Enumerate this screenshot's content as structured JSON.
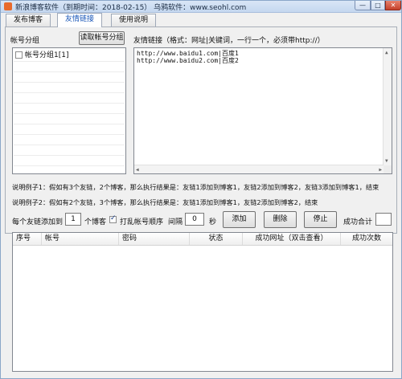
{
  "window": {
    "title": "新浪博客软件（到期时间：2018-02-15）   乌鸦软件：www.seohl.com",
    "min_glyph": "—",
    "max_glyph": "□",
    "close_glyph": "✕"
  },
  "tabs": [
    {
      "label": "发布博客",
      "active": false
    },
    {
      "label": "友情链接",
      "active": true
    },
    {
      "label": "使用说明",
      "active": false
    }
  ],
  "account_section": {
    "label": "帐号分组",
    "read_button": "读取帐号分组",
    "groups": [
      {
        "label": "帐号分组1[1]",
        "checked": false
      }
    ]
  },
  "friend_links": {
    "label": "友情链接（格式：网址|关键词，一行一个，必须带http://）",
    "lines": [
      "http://www.baidu1.com|百度1",
      "http://www.baidu2.com|百度2"
    ]
  },
  "examples": {
    "line1": "说明例子1：假如有3个友链，2个博客，那么执行结果是：友链1添加到博客1，友链2添加到博客2，友链3添加到博客1，结束",
    "line2": "说明例子2：假如有2个友链，3个博客，那么执行结果是：友链1添加到博客1，友链2添加到博客2，结束"
  },
  "controls": {
    "per_link_prefix": "每个友链添加到",
    "per_link_value": "1",
    "per_link_suffix": "个博客",
    "shuffle_label": "打乱帐号顺序",
    "shuffle_checked": true,
    "interval_label": "间隔",
    "interval_value": "0",
    "interval_unit": "秒",
    "add_button": "添加",
    "delete_button": "删除",
    "stop_button": "停止",
    "success_total_label": "成功合计",
    "success_total_value": ""
  },
  "table": {
    "columns": [
      "序号",
      "帐号",
      "密码",
      "状态",
      "成功网址（双击查看）",
      "成功次数"
    ],
    "rows": []
  }
}
